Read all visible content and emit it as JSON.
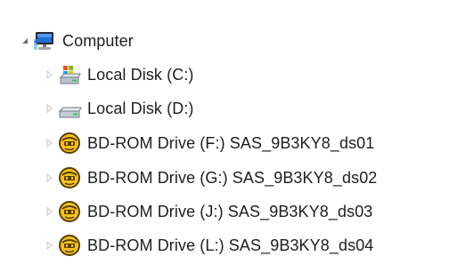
{
  "tree": {
    "root": {
      "label": "Computer",
      "icon": "computer-icon",
      "expanded": true
    },
    "items": [
      {
        "label": "Local Disk (C:)",
        "icon": "system-drive-icon"
      },
      {
        "label": "Local Disk (D:)",
        "icon": "hard-drive-icon"
      },
      {
        "label": "BD-ROM Drive (F:) SAS_9B3KY8_ds01",
        "icon": "bd-rom-drive-icon"
      },
      {
        "label": "BD-ROM Drive (G:) SAS_9B3KY8_ds02",
        "icon": "bd-rom-drive-icon"
      },
      {
        "label": "BD-ROM Drive (J:) SAS_9B3KY8_ds03",
        "icon": "bd-rom-drive-icon"
      },
      {
        "label": "BD-ROM Drive (L:) SAS_9B3KY8_ds04",
        "icon": "bd-rom-drive-icon"
      }
    ]
  },
  "colors": {
    "text": "#1e1e1e",
    "expander_arrow": "#d0d0d0",
    "bd_yellow": "#f2c21a",
    "bd_outline": "#5a3d06"
  }
}
